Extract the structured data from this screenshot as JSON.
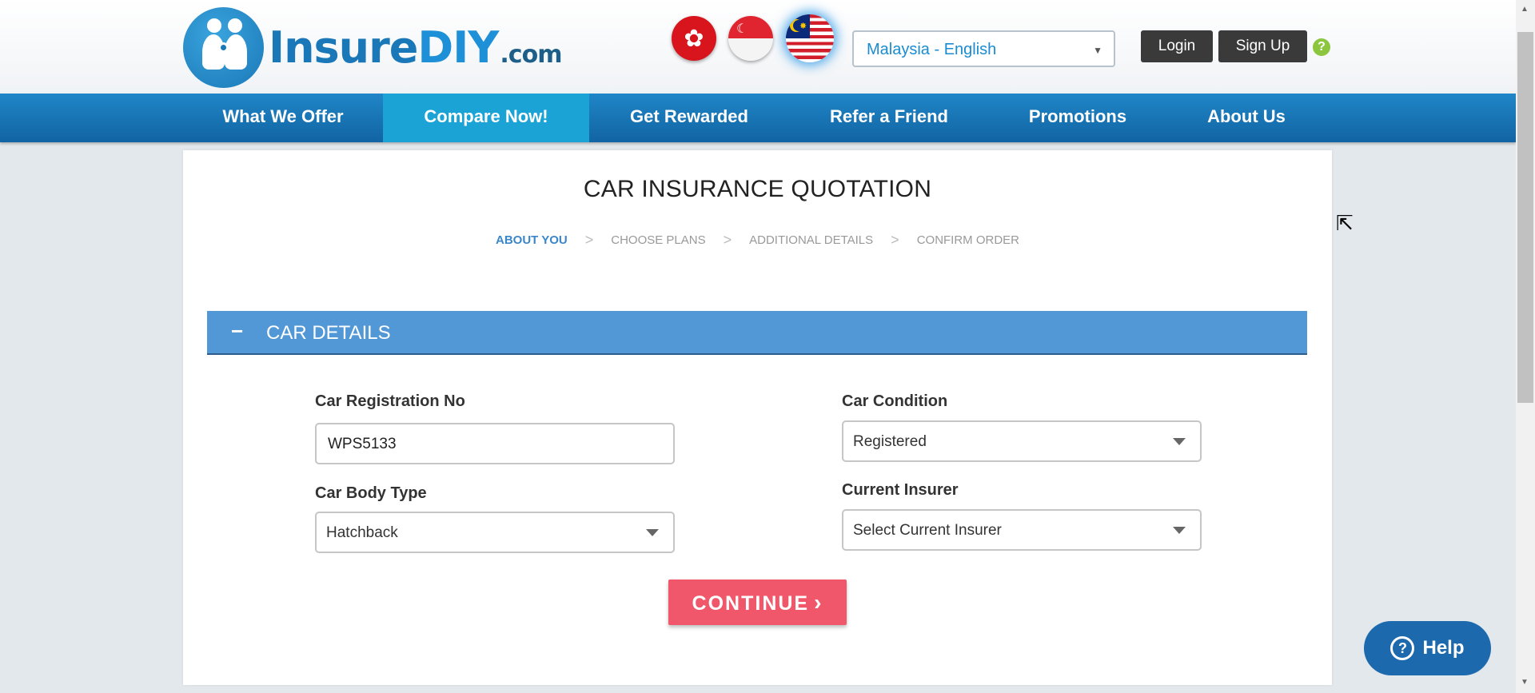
{
  "brand": {
    "logo_main": "Insure",
    "logo_diy": "DIY",
    "logo_suffix": ".com"
  },
  "header": {
    "flags": [
      "hong-kong-flag-icon",
      "singapore-flag-icon",
      "malaysia-flag-icon"
    ],
    "language_select": "Malaysia - English",
    "login": "Login",
    "signup": "Sign Up",
    "help_q": "?"
  },
  "nav": {
    "items": [
      "What We Offer",
      "Compare Now!",
      "Get Rewarded",
      "Refer a Friend",
      "Promotions",
      "About Us"
    ],
    "active_index": 1
  },
  "page": {
    "title": "CAR INSURANCE QUOTATION",
    "steps": [
      "ABOUT YOU",
      "CHOOSE PLANS",
      "ADDITIONAL DETAILS",
      "CONFIRM ORDER"
    ],
    "current_step_index": 0
  },
  "section": {
    "toggle": "−",
    "title": "CAR DETAILS"
  },
  "form": {
    "reg_no_label": "Car Registration No",
    "reg_no_value": "WPS5133",
    "condition_label": "Car Condition",
    "condition_value": "Registered",
    "body_type_label": "Car Body Type",
    "body_type_value": "Hatchback",
    "insurer_label": "Current Insurer",
    "insurer_value": "Select Current Insurer"
  },
  "actions": {
    "continue": "CONTINUE"
  },
  "help_bubble": {
    "icon": "?",
    "label": "Help"
  },
  "colors": {
    "nav_blue": "#1264a3",
    "section_blue": "#5398d6",
    "continue_red": "#f0576b",
    "active_tab": "#1ba3d6"
  }
}
